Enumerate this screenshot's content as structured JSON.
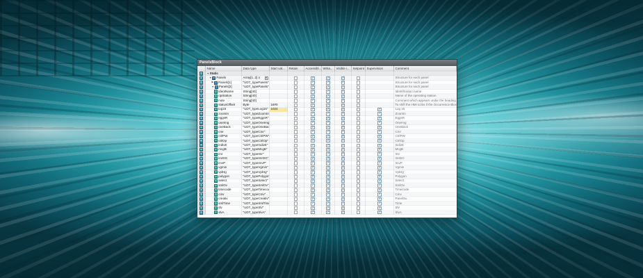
{
  "colors": {
    "check_blue": "#2a6fad",
    "highlight_yellow": "#f7e7a2",
    "titlebar_gray": "#53585d",
    "window_bg": "#eef0f1",
    "background_teal": "#1f919e"
  },
  "icons": {
    "check": "✓",
    "expander_open": "▼",
    "expander_closed": "▶",
    "dropdown": "▾",
    "row_type": "member-cube-icon"
  },
  "window": {
    "title": "PanelsBlock",
    "columns": [
      "Name",
      "Data type",
      "Start val...",
      "Retain",
      "Accessibl...",
      "Writa...",
      "Visible i...",
      "Setpoint",
      "Supervision",
      "Comment"
    ],
    "rows": [
      {
        "ind": 0,
        "exp": "open",
        "kind": "section",
        "n": "Static",
        "t": "",
        "v": "",
        "re": "",
        "ac": "",
        "wr": "",
        "vi": "",
        "sp": "",
        "su": "",
        "cm": ""
      },
      {
        "ind": 1,
        "exp": "open",
        "kind": "struct",
        "n": "Panels",
        "t": "Array[1..2] o",
        "dd": true,
        "v": "",
        "re": "b",
        "ac": "c",
        "wr": "c",
        "vi": "c",
        "sp": "b",
        "su": "",
        "cm": "Structure for each panel"
      },
      {
        "ind": 2,
        "exp": "closed",
        "kind": "struct",
        "n": "Panels[1]",
        "t": "\"UDT_typePanels\"",
        "v": "",
        "re": "b",
        "ac": "c",
        "wr": "c",
        "vi": "c",
        "sp": "b",
        "su": "",
        "cm": "Structure for each panel"
      },
      {
        "ind": 2,
        "exp": "open",
        "kind": "struct",
        "n": "Panels[2]",
        "t": "\"UDT_typePanels\"",
        "v": "",
        "re": "b",
        "ac": "c",
        "wr": "c",
        "vi": "c",
        "sp": "b",
        "su": "",
        "cm": "Structure for each panel"
      },
      {
        "ind": 3,
        "kind": "var",
        "n": "identName",
        "t": "String[40]",
        "v": "",
        "re": "b",
        "ac": "c",
        "wr": "c",
        "vi": "c",
        "sp": "b",
        "su": "",
        "cm": "Identification name"
      },
      {
        "ind": 3,
        "kind": "var",
        "n": "opStation",
        "t": "String[40]",
        "v": "",
        "re": "b",
        "ac": "c",
        "wr": "c",
        "vi": "c",
        "sp": "b",
        "su": "",
        "cm": "Name of the operating station"
      },
      {
        "ind": 3,
        "kind": "var",
        "n": "note",
        "t": "String[40]",
        "v": "",
        "re": "b",
        "ac": "c",
        "wr": "c",
        "vi": "c",
        "sp": "b",
        "su": "",
        "cm": "Comment which appears under the heading"
      },
      {
        "ind": 3,
        "kind": "var",
        "n": "statusOffset",
        "t": "Byte",
        "v": "16#0",
        "re": "b",
        "ac": "c",
        "wr": "c",
        "vi": "c",
        "sp": "b",
        "su": "",
        "cm": "To shift the HMI icons if the Occurrence Block Hea"
      },
      {
        "ind": 3,
        "kind": "var",
        "n": "log16",
        "t": "\"UDT_typeLog16\"",
        "v": "1024",
        "hl": true,
        "re": "b",
        "ac": "c",
        "wr": "c",
        "vi": "c",
        "sp": "b",
        "su": "c",
        "cm": "Log 16"
      },
      {
        "ind": 3,
        "kind": "var",
        "n": "zoomIn",
        "t": "\"UDT_typeZoomIn\"",
        "v": "",
        "re": "b",
        "ac": "c",
        "wr": "c",
        "vi": "c",
        "sp": "b",
        "su": "c",
        "cm": "ZoomIn"
      },
      {
        "ind": 3,
        "kind": "var",
        "n": "eggsR",
        "t": "\"UDT_typeEggsR\"",
        "v": "",
        "re": "b",
        "ac": "c",
        "wr": "c",
        "vi": "c",
        "sp": "b",
        "su": "c",
        "cm": "EggsR"
      },
      {
        "ind": 3,
        "kind": "var",
        "n": "oneImg",
        "t": "\"UDT_typeOneImg\"",
        "v": "",
        "re": "b",
        "ac": "c",
        "wr": "c",
        "vi": "c",
        "sp": "b",
        "su": "c",
        "cm": "OneImg"
      },
      {
        "ind": 3,
        "kind": "var",
        "n": "oneBack",
        "t": "\"UDT_typeOneBack\"",
        "v": "",
        "re": "b",
        "ac": "c",
        "wr": "c",
        "vi": "c",
        "sp": "b",
        "su": "c",
        "cm": "OneBack"
      },
      {
        "ind": 3,
        "kind": "var",
        "n": "cmr",
        "t": "\"UDT_typeCmr\"",
        "v": "",
        "re": "b",
        "ac": "c",
        "wr": "c",
        "vi": "c",
        "sp": "b",
        "su": "c",
        "cm": "Cmr"
      },
      {
        "ind": 3,
        "kind": "var",
        "n": "ctrlPW",
        "t": "\"UDT_typeCtrlPW\"",
        "v": "",
        "re": "b",
        "ac": "c",
        "wr": "c",
        "vi": "c",
        "sp": "b",
        "su": "c",
        "cm": "CtrlPW"
      },
      {
        "ind": 3,
        "kind": "var",
        "n": "ctrlOp",
        "t": "\"UDT_typeCtrlOp\"",
        "v": "",
        "re": "b",
        "ac": "c",
        "wr": "c",
        "vi": "c",
        "sp": "b",
        "su": "c",
        "cm": "CtrlOp"
      },
      {
        "ind": 3,
        "kind": "var",
        "n": "indivE",
        "t": "\"UDT_typeIndivE\"",
        "v": "",
        "re": "b",
        "ac": "c",
        "wr": "c",
        "vi": "c",
        "sp": "b",
        "su": "c",
        "cm": "IndivE"
      },
      {
        "ind": 3,
        "kind": "var",
        "n": "mcgB",
        "t": "\"UDT_typeMcgB\"",
        "v": "",
        "re": "b",
        "ac": "c",
        "wr": "c",
        "vi": "c",
        "sp": "b",
        "su": "c",
        "cm": "McgB"
      },
      {
        "ind": 3,
        "kind": "var",
        "n": "imr",
        "t": "\"UDT_typeImr\"",
        "v": "",
        "re": "b",
        "ac": "c",
        "wr": "c",
        "vi": "c",
        "sp": "b",
        "su": "c",
        "cm": "Imr"
      },
      {
        "ind": 3,
        "kind": "var",
        "n": "imrDG",
        "t": "\"UDT_typeImrDG\"",
        "v": "",
        "re": "b",
        "ac": "c",
        "wr": "c",
        "vi": "c",
        "sp": "b",
        "su": "c",
        "cm": "ImrDG"
      },
      {
        "ind": 3,
        "kind": "var",
        "n": "imvP",
        "t": "\"UDT_typeImvP\"",
        "v": "",
        "re": "b",
        "ac": "c",
        "wr": "c",
        "vi": "c",
        "sp": "b",
        "su": "c",
        "cm": "ImvP"
      },
      {
        "ind": 3,
        "kind": "var",
        "n": "vgmin",
        "t": "\"UDT_typeVgmin\"",
        "v": "",
        "re": "b",
        "ac": "c",
        "wr": "c",
        "vi": "c",
        "sp": "b",
        "su": "c",
        "cm": "Vgmin"
      },
      {
        "ind": 3,
        "kind": "var",
        "n": "vplHg",
        "t": "\"UDT_typeVplHg\"",
        "v": "",
        "re": "b",
        "ac": "c",
        "wr": "c",
        "vi": "c",
        "sp": "b",
        "su": "c",
        "cm": "VplHg"
      },
      {
        "ind": 3,
        "kind": "var",
        "n": "polygon",
        "t": "\"UDT_typePolygon\"",
        "v": "",
        "re": "b",
        "ac": "c",
        "wr": "c",
        "vi": "c",
        "sp": "b",
        "su": "c",
        "cm": "Polygon"
      },
      {
        "ind": 3,
        "kind": "var",
        "n": "select",
        "t": "\"UDT_typeSelect\"",
        "v": "",
        "re": "b",
        "ac": "c",
        "wr": "c",
        "vi": "c",
        "sp": "b",
        "su": "c",
        "cm": "Select"
      },
      {
        "ind": 3,
        "kind": "var",
        "n": "smlOv",
        "t": "\"UDT_typeSmlOv\"",
        "v": "",
        "re": "b",
        "ac": "c",
        "wr": "c",
        "vi": "c",
        "sp": "b",
        "su": "c",
        "cm": "SmlOv"
      },
      {
        "ind": 3,
        "kind": "var",
        "n": "timecode",
        "t": "\"UDT_typeTimecode\"",
        "v": "",
        "re": "b",
        "ac": "c",
        "wr": "c",
        "vi": "c",
        "sp": "b",
        "su": "c",
        "cm": "Timecode"
      },
      {
        "ind": 3,
        "kind": "var",
        "n": "cmv",
        "t": "\"UDT_typeCmv\"",
        "v": "",
        "re": "b",
        "ac": "c",
        "wr": "c",
        "vi": "c",
        "sp": "b",
        "su": "c",
        "cm": "Cmv"
      },
      {
        "ind": 3,
        "kind": "var",
        "n": "creativ",
        "t": "\"UDT_typeCreativ\"",
        "v": "",
        "re": "b",
        "ac": "c",
        "wr": "c",
        "vi": "c",
        "sp": "b",
        "su": "c",
        "cm": "PanelSu"
      },
      {
        "ind": 3,
        "kind": "var",
        "n": "smlTime",
        "t": "\"UDT_typeSmlTime\"",
        "v": "",
        "re": "b",
        "ac": "c",
        "wr": "c",
        "vi": "c",
        "sp": "b",
        "su": "c",
        "cm": "Time"
      },
      {
        "ind": 3,
        "kind": "var",
        "n": "slv",
        "t": "\"UDT_typeSlv\"",
        "v": "",
        "re": "b",
        "ac": "c",
        "wr": "c",
        "vi": "c",
        "sp": "b",
        "su": "c",
        "cm": "Slv"
      },
      {
        "ind": 3,
        "kind": "var",
        "n": "slvA",
        "t": "\"UDT_typeSlvA\"",
        "v": "",
        "re": "b",
        "ac": "c",
        "wr": "c",
        "vi": "c",
        "sp": "b",
        "su": "c",
        "cm": "SlvA"
      }
    ]
  }
}
